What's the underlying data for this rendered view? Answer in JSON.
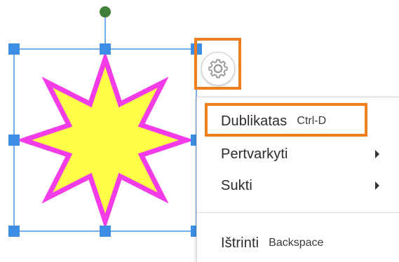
{
  "canvas": {
    "shape": "eight-point-star",
    "shape_fill": "#ffff47",
    "shape_stroke": "#f23ce8",
    "selection_color": "#4a90e2",
    "rotate_handle_color": "#3f7f3a"
  },
  "gear_button": {
    "icon": "gear-icon",
    "highlight_color": "#f07d1e"
  },
  "context_menu": {
    "items": [
      {
        "label": "Dublikatas",
        "shortcut": "Ctrl-D",
        "has_submenu": false
      },
      {
        "label": "Pertvarkyti",
        "shortcut": "",
        "has_submenu": true
      },
      {
        "label": "Sukti",
        "shortcut": "",
        "has_submenu": true
      },
      {
        "label": "Ištrinti",
        "shortcut": "Backspace",
        "has_submenu": false
      }
    ]
  }
}
